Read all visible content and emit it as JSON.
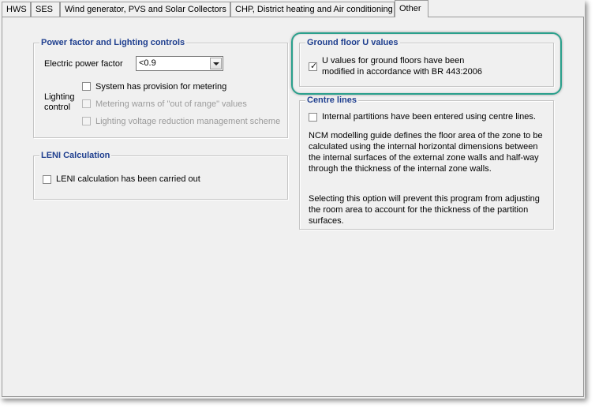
{
  "tabs": [
    "HWS",
    "SES",
    "Wind generator, PVS and Solar Collectors",
    "CHP, District heating and Air conditioning",
    "Other"
  ],
  "active_tab": "Other",
  "power_factor_group": {
    "title": "Power factor and Lighting controls",
    "power_factor_label": "Electric power factor",
    "power_factor_value": "<0.9",
    "lighting_control_label_line1": "Lighting",
    "lighting_control_label_line2": "control",
    "options": [
      {
        "label": "System has provision for metering",
        "checked": false,
        "enabled": true
      },
      {
        "label": "Metering warns of \"out of range\" values",
        "checked": false,
        "enabled": false
      },
      {
        "label": "Lighting voltage reduction management scheme",
        "checked": false,
        "enabled": false
      }
    ]
  },
  "leni_group": {
    "title": "LENI Calculation",
    "option": {
      "label": "LENI calculation has been carried out",
      "checked": false
    }
  },
  "ground_floor_group": {
    "title": "Ground floor U values",
    "option": {
      "line1": "U values for ground floors have been",
      "line2": "modified in accordance with BR 443:2006",
      "checked": true
    }
  },
  "centre_lines_group": {
    "title": "Centre lines",
    "option": {
      "label": "Internal partitions have been entered using centre lines.",
      "checked": false
    },
    "paragraph1": [
      "NCM modelling guide defines the floor area of the zone to be",
      "calculated using the internal horizontal dimensions between",
      "the internal surfaces of the external zone walls and half-way",
      "through the thickness of the internal zone walls."
    ],
    "paragraph2": [
      "Selecting this option will prevent this program from adjusting",
      "the room area to account for the thickness of the partition",
      "surfaces."
    ]
  },
  "colors": {
    "highlight": "#2aa08c",
    "group_title": "#1f3f8f"
  }
}
